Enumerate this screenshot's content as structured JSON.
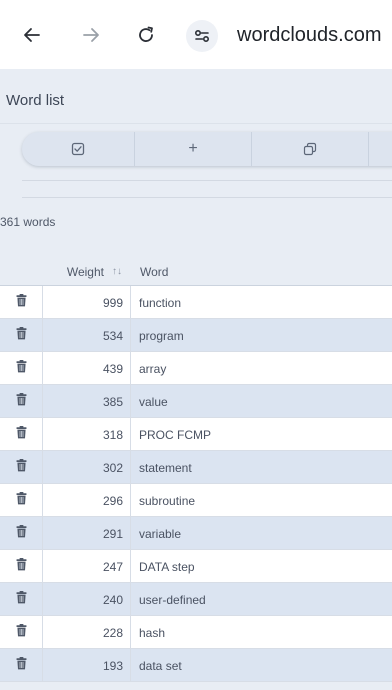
{
  "browser": {
    "url": "wordclouds.com"
  },
  "panel": {
    "title": "Word list",
    "word_count": "361 words"
  },
  "toolbar": {
    "add_label": "+"
  },
  "table": {
    "headers": {
      "weight": "Weight",
      "sort_indicator": "↑↓",
      "word": "Word"
    },
    "rows": [
      {
        "weight": "999",
        "word": "function"
      },
      {
        "weight": "534",
        "word": "program"
      },
      {
        "weight": "439",
        "word": "array"
      },
      {
        "weight": "385",
        "word": "value"
      },
      {
        "weight": "318",
        "word": "PROC FCMP"
      },
      {
        "weight": "302",
        "word": "statement"
      },
      {
        "weight": "296",
        "word": "subroutine"
      },
      {
        "weight": "291",
        "word": "variable"
      },
      {
        "weight": "247",
        "word": "DATA step"
      },
      {
        "weight": "240",
        "word": "user-defined"
      },
      {
        "weight": "228",
        "word": "hash"
      },
      {
        "weight": "193",
        "word": "data set"
      }
    ]
  },
  "icons": {
    "back": "back-arrow-icon",
    "forward": "forward-arrow-icon",
    "reload": "reload-icon",
    "site_settings": "site-settings-icon",
    "delete": "trash-icon"
  },
  "colors": {
    "panel_bg": "#e8edf4",
    "row_alt": "#dbe4f1",
    "toolbar_bg": "#dde4ef"
  }
}
